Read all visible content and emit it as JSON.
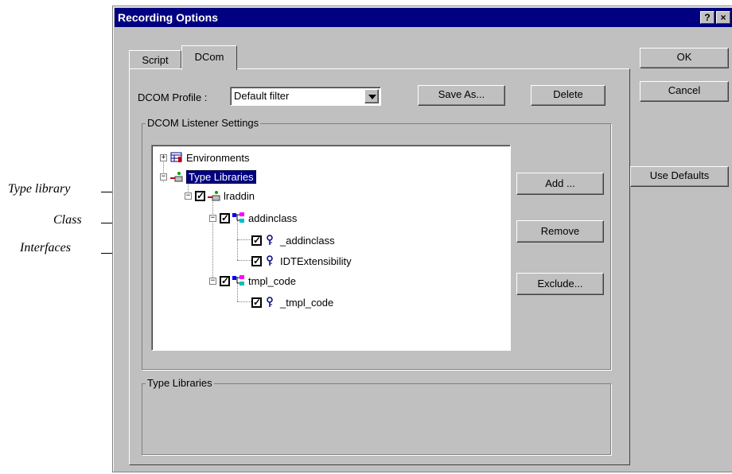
{
  "callouts": {
    "type_library": "Type library",
    "class": "Class",
    "interfaces": "Interfaces"
  },
  "dialog": {
    "title": "Recording Options",
    "help_glyph": "?",
    "close_glyph": "×"
  },
  "tabs": [
    {
      "label": "Script",
      "selected": false
    },
    {
      "label": "DCom",
      "selected": true
    }
  ],
  "buttons": {
    "ok": "OK",
    "cancel": "Cancel",
    "use_defaults": "Use Defaults",
    "save_as": "Save As...",
    "delete": "Delete",
    "add": "Add ...",
    "remove": "Remove",
    "exclude": "Exclude..."
  },
  "profile": {
    "label": "DCOM Profile :",
    "value": "Default filter"
  },
  "groups": {
    "listener_settings": "DCOM Listener Settings",
    "type_libraries": "Type Libraries"
  },
  "tree": [
    {
      "label": "Environments",
      "expander": "+",
      "checked": null,
      "icon": "environments-icon",
      "level": 0
    },
    {
      "label": "Type Libraries",
      "expander": "−",
      "checked": null,
      "icon": "type-libraries-icon",
      "level": 0,
      "selected": true
    },
    {
      "label": "lraddin",
      "expander": "−",
      "checked": true,
      "icon": "library-icon",
      "level": 1
    },
    {
      "label": "addinclass",
      "expander": "−",
      "checked": true,
      "icon": "class-icon",
      "level": 2
    },
    {
      "label": "_addinclass",
      "expander": null,
      "checked": true,
      "icon": "interface-icon",
      "level": 3
    },
    {
      "label": "IDTExtensibility",
      "expander": null,
      "checked": true,
      "icon": "interface-icon",
      "level": 3
    },
    {
      "label": "tmpl_code",
      "expander": "−",
      "checked": true,
      "icon": "class-icon",
      "level": 2
    },
    {
      "label": "_tmpl_code",
      "expander": null,
      "checked": true,
      "icon": "interface-icon",
      "level": 3
    }
  ],
  "colors": {
    "titlebar": "#000080",
    "face": "#c0c0c0",
    "selection": "#000080"
  }
}
